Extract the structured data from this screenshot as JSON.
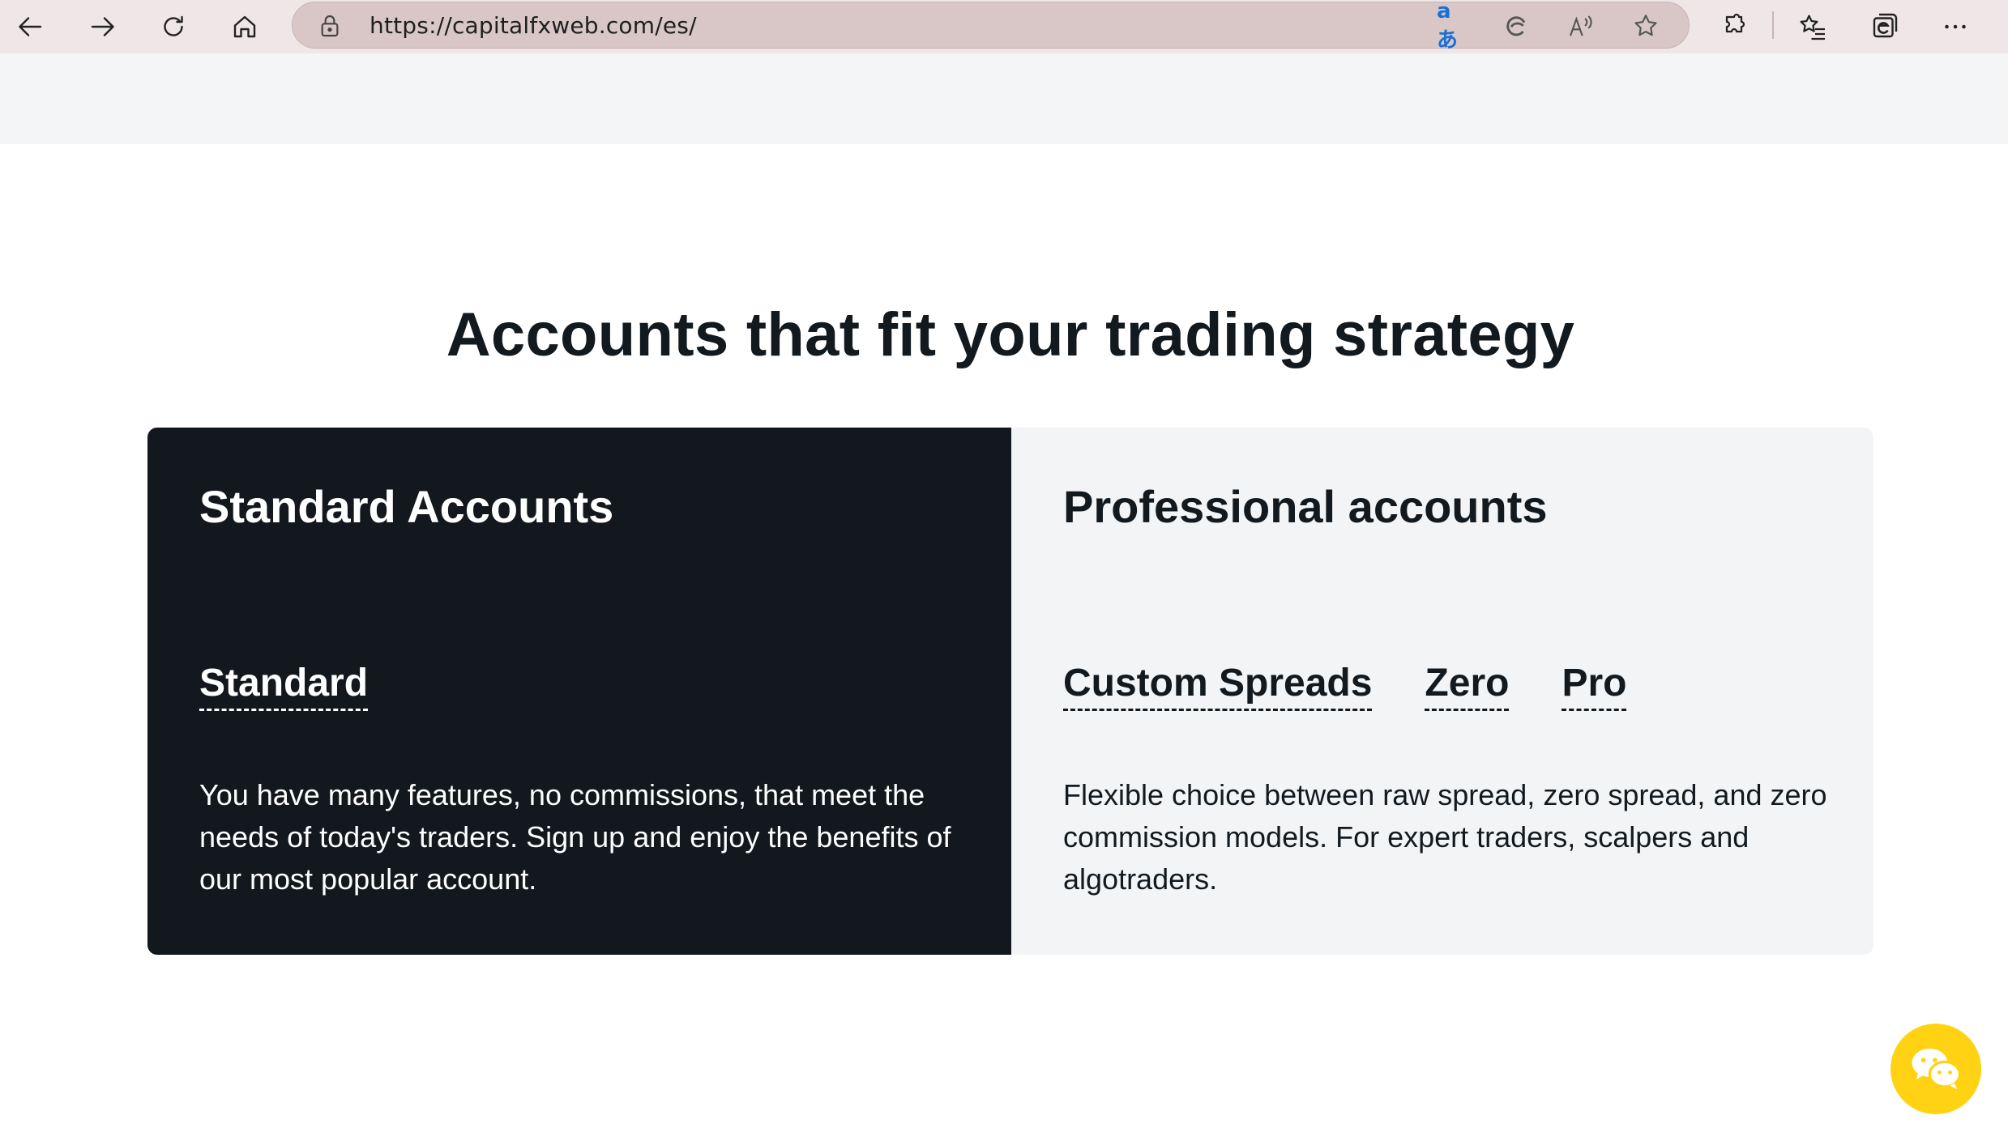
{
  "browser": {
    "url": "https://capitalfxweb.com/es/",
    "translate_glyph": "aあ"
  },
  "page": {
    "headline": "Accounts that fit your trading strategy"
  },
  "standard_card": {
    "title": "Standard Accounts",
    "tabs": [
      {
        "label": "Standard"
      }
    ],
    "description": "You have many features, no commissions, that meet the needs of today's traders. Sign up and enjoy the benefits of our most popular account."
  },
  "professional_card": {
    "title": "Professional accounts",
    "tabs": [
      {
        "label": "Custom Spreads"
      },
      {
        "label": "Zero"
      },
      {
        "label": "Pro"
      }
    ],
    "description": "Flexible choice between raw spread, zero spread, and zero commission models. For expert traders, scalpers and algotraders."
  },
  "colors": {
    "dark_card": "#12181d",
    "light_card": "#f3f4f5",
    "chat_accent": "#ffd313",
    "toolbar": "#efe7e7"
  },
  "icons": {
    "chat": "wechat-icon"
  }
}
